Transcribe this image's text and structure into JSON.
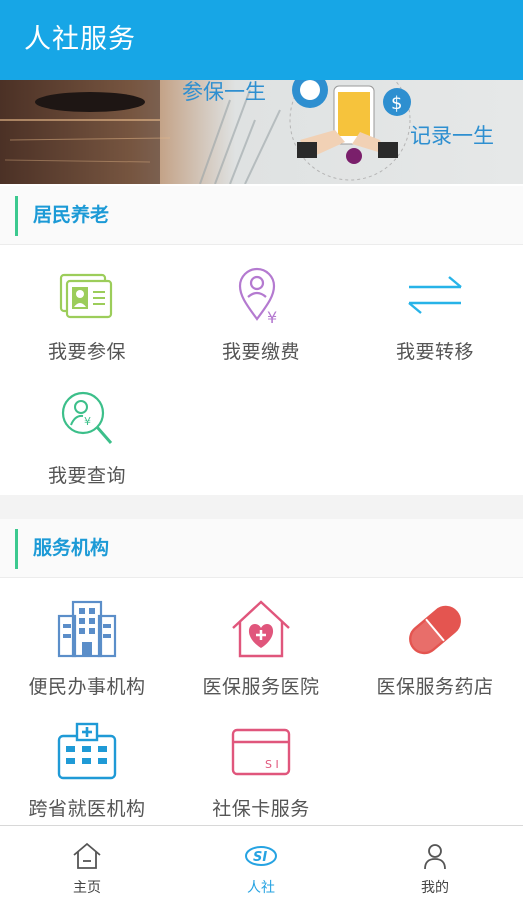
{
  "app": {
    "title": "人社服务"
  },
  "banner": {
    "caption_1": "参保一生",
    "caption_2": "记录一生"
  },
  "sections": {
    "pension": {
      "title": "居民养老",
      "items": [
        {
          "label": "我要参保",
          "icon": "id-card-icon"
        },
        {
          "label": "我要缴费",
          "icon": "location-yuan-icon"
        },
        {
          "label": "我要转移",
          "icon": "transfer-arrows-icon"
        },
        {
          "label": "我要查询",
          "icon": "search-person-icon"
        }
      ]
    },
    "institutions": {
      "title": "服务机构",
      "items": [
        {
          "label": "便民办事机构",
          "icon": "office-building-icon"
        },
        {
          "label": "医保服务医院",
          "icon": "hospital-heart-icon"
        },
        {
          "label": "医保服务药店",
          "icon": "pill-capsule-icon"
        },
        {
          "label": "跨省就医机构",
          "icon": "medical-building-icon"
        },
        {
          "label": "社保卡服务",
          "icon": "si-card-icon"
        }
      ]
    }
  },
  "nav": {
    "items": [
      {
        "label": "主页",
        "icon": "home-icon"
      },
      {
        "label": "人社",
        "icon": "si-logo-icon",
        "active": true
      },
      {
        "label": "我的",
        "icon": "person-icon"
      }
    ]
  },
  "colors": {
    "primary": "#17a6e6",
    "section_accent": "#3cc98f",
    "section_title": "#1c9ad6",
    "nav_active": "#26a3e2"
  }
}
